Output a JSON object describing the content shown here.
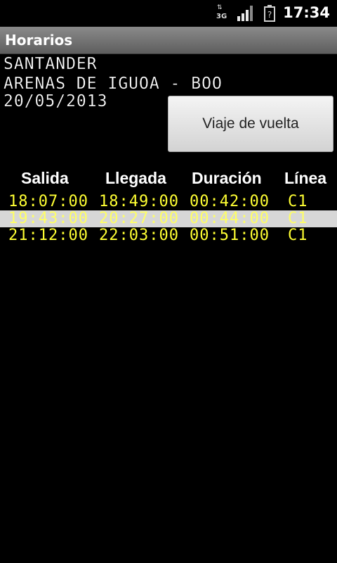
{
  "status_bar": {
    "network_label": "3G",
    "network_arrows": "⇅",
    "time": "17:34",
    "icons": [
      "network-3g-icon",
      "signal-icon",
      "battery-icon"
    ]
  },
  "title_bar": {
    "title": "Horarios"
  },
  "route": {
    "origin": "SANTANDER",
    "destination": "ARENAS DE IGUOA - BOO",
    "date": "20/05/2013"
  },
  "return_button": {
    "label": "Viaje de vuelta"
  },
  "table": {
    "headers": [
      "Salida",
      "Llegada",
      "Duración",
      "Línea"
    ],
    "rows": [
      {
        "salida": "18:07:00",
        "llegada": "18:49:00",
        "duracion": "00:42:00",
        "linea": "C1",
        "selected": false
      },
      {
        "salida": "19:43:00",
        "llegada": "20:27:00",
        "duracion": "00:44:00",
        "linea": "C1",
        "selected": true
      },
      {
        "salida": "21:12:00",
        "llegada": "22:03:00",
        "duracion": "00:51:00",
        "linea": "C1",
        "selected": false
      }
    ]
  },
  "colors": {
    "background": "#000000",
    "schedule_text": "#ffff33",
    "selected_row": "#d7d7d7"
  }
}
